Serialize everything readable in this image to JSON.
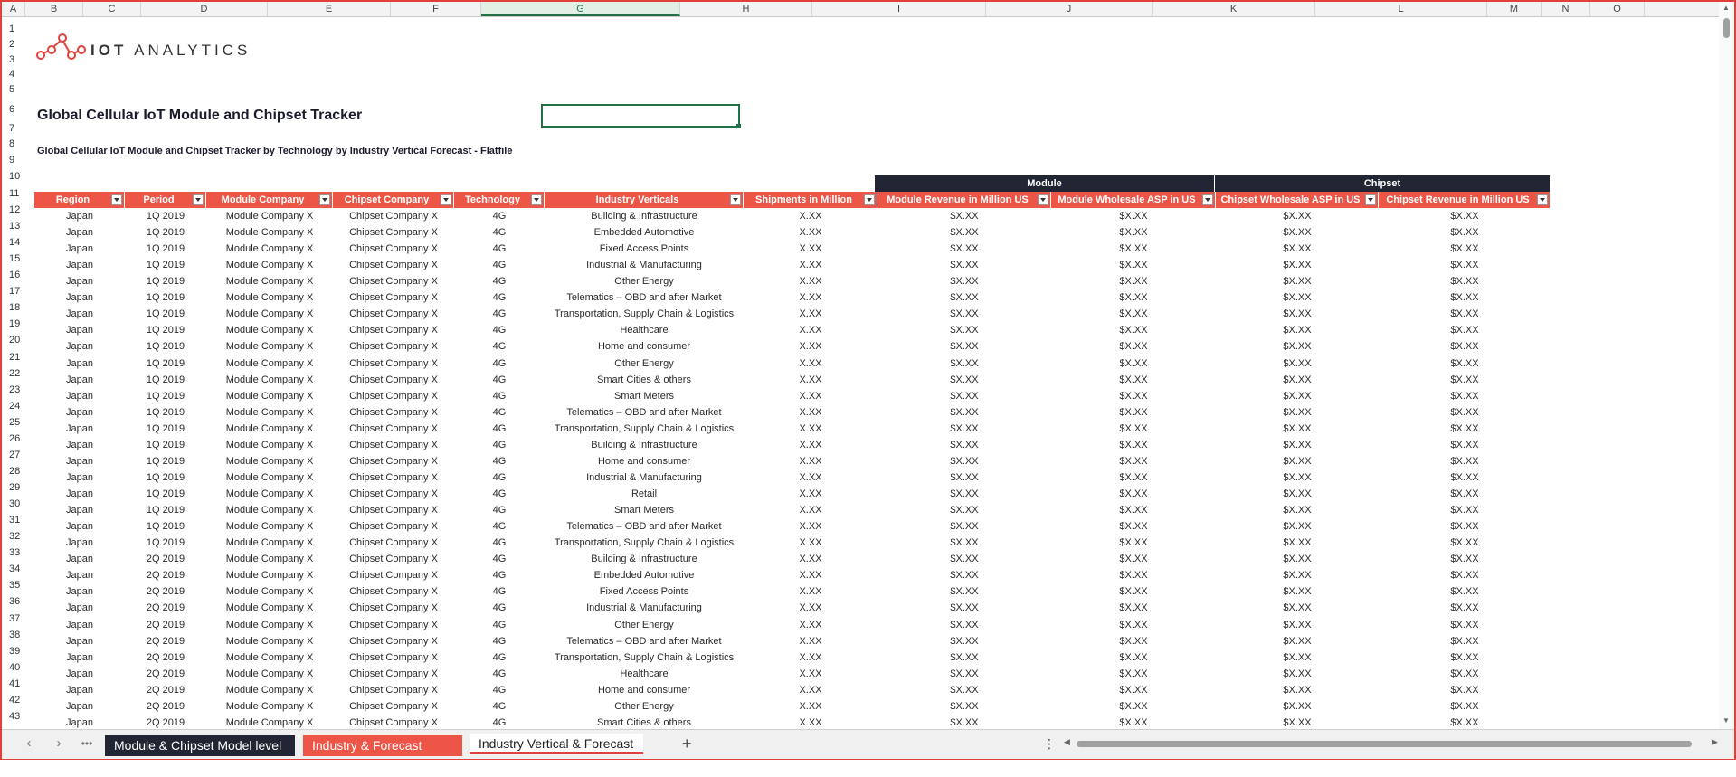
{
  "columns": [
    "A",
    "B",
    "C",
    "D",
    "E",
    "F",
    "G",
    "H",
    "I",
    "J",
    "K",
    "L",
    "M",
    "N",
    "O"
  ],
  "selected_column": "G",
  "rows": [
    "1",
    "2",
    "3",
    "4",
    "5",
    "6",
    "7",
    "8",
    "9",
    "10",
    "11",
    "12",
    "13",
    "14",
    "15",
    "16",
    "17",
    "18",
    "19",
    "20",
    "21",
    "22",
    "23",
    "24",
    "25",
    "26",
    "27",
    "28",
    "29",
    "30",
    "31",
    "32",
    "33",
    "34",
    "35",
    "36",
    "37",
    "38",
    "39",
    "40",
    "41",
    "42",
    "43"
  ],
  "brand": {
    "strong": "IOT",
    "rest": "ANALYTICS"
  },
  "title": "Global Cellular IoT Module and Chipset Tracker",
  "subtitle": "Global Cellular IoT Module and Chipset Tracker by Technology by Industry Vertical Forecast - Flatfile",
  "groups": {
    "module": "Module",
    "chipset": "Chipset"
  },
  "headers": [
    "Region",
    "Period",
    "Module Company",
    "Chipset Company",
    "Technology",
    "Industry Verticals",
    "Shipments in Million",
    "Module Revenue in Million US",
    "Module Wholesale ASP in US",
    "Chipset Wholesale ASP in US",
    "Chipset Revenue in Million US"
  ],
  "table_rows": [
    [
      "Japan",
      "1Q 2019",
      "Module Company X",
      "Chipset Company X",
      "4G",
      "Building & Infrastructure",
      "X.XX",
      "$X.XX",
      "$X.XX",
      "$X.XX",
      "$X.XX"
    ],
    [
      "Japan",
      "1Q 2019",
      "Module Company X",
      "Chipset Company X",
      "4G",
      "Embedded Automotive",
      "X.XX",
      "$X.XX",
      "$X.XX",
      "$X.XX",
      "$X.XX"
    ],
    [
      "Japan",
      "1Q 2019",
      "Module Company X",
      "Chipset Company X",
      "4G",
      "Fixed Access Points",
      "X.XX",
      "$X.XX",
      "$X.XX",
      "$X.XX",
      "$X.XX"
    ],
    [
      "Japan",
      "1Q 2019",
      "Module Company X",
      "Chipset Company X",
      "4G",
      "Industrial & Manufacturing",
      "X.XX",
      "$X.XX",
      "$X.XX",
      "$X.XX",
      "$X.XX"
    ],
    [
      "Japan",
      "1Q 2019",
      "Module Company X",
      "Chipset Company X",
      "4G",
      "Other Energy",
      "X.XX",
      "$X.XX",
      "$X.XX",
      "$X.XX",
      "$X.XX"
    ],
    [
      "Japan",
      "1Q 2019",
      "Module Company X",
      "Chipset Company X",
      "4G",
      "Telematics – OBD and after Market",
      "X.XX",
      "$X.XX",
      "$X.XX",
      "$X.XX",
      "$X.XX"
    ],
    [
      "Japan",
      "1Q 2019",
      "Module Company X",
      "Chipset Company X",
      "4G",
      "Transportation, Supply Chain & Logistics",
      "X.XX",
      "$X.XX",
      "$X.XX",
      "$X.XX",
      "$X.XX"
    ],
    [
      "Japan",
      "1Q 2019",
      "Module Company X",
      "Chipset Company X",
      "4G",
      "Healthcare",
      "X.XX",
      "$X.XX",
      "$X.XX",
      "$X.XX",
      "$X.XX"
    ],
    [
      "Japan",
      "1Q 2019",
      "Module Company X",
      "Chipset Company X",
      "4G",
      "Home and consumer",
      "X.XX",
      "$X.XX",
      "$X.XX",
      "$X.XX",
      "$X.XX"
    ],
    [
      "Japan",
      "1Q 2019",
      "Module Company X",
      "Chipset Company X",
      "4G",
      "Other Energy",
      "X.XX",
      "$X.XX",
      "$X.XX",
      "$X.XX",
      "$X.XX"
    ],
    [
      "Japan",
      "1Q 2019",
      "Module Company X",
      "Chipset Company X",
      "4G",
      "Smart Cities & others",
      "X.XX",
      "$X.XX",
      "$X.XX",
      "$X.XX",
      "$X.XX"
    ],
    [
      "Japan",
      "1Q 2019",
      "Module Company X",
      "Chipset Company X",
      "4G",
      "Smart Meters",
      "X.XX",
      "$X.XX",
      "$X.XX",
      "$X.XX",
      "$X.XX"
    ],
    [
      "Japan",
      "1Q 2019",
      "Module Company X",
      "Chipset Company X",
      "4G",
      "Telematics – OBD and after Market",
      "X.XX",
      "$X.XX",
      "$X.XX",
      "$X.XX",
      "$X.XX"
    ],
    [
      "Japan",
      "1Q 2019",
      "Module Company X",
      "Chipset Company X",
      "4G",
      "Transportation, Supply Chain & Logistics",
      "X.XX",
      "$X.XX",
      "$X.XX",
      "$X.XX",
      "$X.XX"
    ],
    [
      "Japan",
      "1Q 2019",
      "Module Company X",
      "Chipset Company X",
      "4G",
      "Building & Infrastructure",
      "X.XX",
      "$X.XX",
      "$X.XX",
      "$X.XX",
      "$X.XX"
    ],
    [
      "Japan",
      "1Q 2019",
      "Module Company X",
      "Chipset Company X",
      "4G",
      "Home and consumer",
      "X.XX",
      "$X.XX",
      "$X.XX",
      "$X.XX",
      "$X.XX"
    ],
    [
      "Japan",
      "1Q 2019",
      "Module Company X",
      "Chipset Company X",
      "4G",
      "Industrial & Manufacturing",
      "X.XX",
      "$X.XX",
      "$X.XX",
      "$X.XX",
      "$X.XX"
    ],
    [
      "Japan",
      "1Q 2019",
      "Module Company X",
      "Chipset Company X",
      "4G",
      "Retail",
      "X.XX",
      "$X.XX",
      "$X.XX",
      "$X.XX",
      "$X.XX"
    ],
    [
      "Japan",
      "1Q 2019",
      "Module Company X",
      "Chipset Company X",
      "4G",
      "Smart Meters",
      "X.XX",
      "$X.XX",
      "$X.XX",
      "$X.XX",
      "$X.XX"
    ],
    [
      "Japan",
      "1Q 2019",
      "Module Company X",
      "Chipset Company X",
      "4G",
      "Telematics – OBD and after Market",
      "X.XX",
      "$X.XX",
      "$X.XX",
      "$X.XX",
      "$X.XX"
    ],
    [
      "Japan",
      "1Q 2019",
      "Module Company X",
      "Chipset Company X",
      "4G",
      "Transportation, Supply Chain & Logistics",
      "X.XX",
      "$X.XX",
      "$X.XX",
      "$X.XX",
      "$X.XX"
    ],
    [
      "Japan",
      "2Q 2019",
      "Module Company X",
      "Chipset Company X",
      "4G",
      "Building & Infrastructure",
      "X.XX",
      "$X.XX",
      "$X.XX",
      "$X.XX",
      "$X.XX"
    ],
    [
      "Japan",
      "2Q 2019",
      "Module Company X",
      "Chipset Company X",
      "4G",
      "Embedded Automotive",
      "X.XX",
      "$X.XX",
      "$X.XX",
      "$X.XX",
      "$X.XX"
    ],
    [
      "Japan",
      "2Q 2019",
      "Module Company X",
      "Chipset Company X",
      "4G",
      "Fixed Access Points",
      "X.XX",
      "$X.XX",
      "$X.XX",
      "$X.XX",
      "$X.XX"
    ],
    [
      "Japan",
      "2Q 2019",
      "Module Company X",
      "Chipset Company X",
      "4G",
      "Industrial & Manufacturing",
      "X.XX",
      "$X.XX",
      "$X.XX",
      "$X.XX",
      "$X.XX"
    ],
    [
      "Japan",
      "2Q 2019",
      "Module Company X",
      "Chipset Company X",
      "4G",
      "Other Energy",
      "X.XX",
      "$X.XX",
      "$X.XX",
      "$X.XX",
      "$X.XX"
    ],
    [
      "Japan",
      "2Q 2019",
      "Module Company X",
      "Chipset Company X",
      "4G",
      "Telematics – OBD and after Market",
      "X.XX",
      "$X.XX",
      "$X.XX",
      "$X.XX",
      "$X.XX"
    ],
    [
      "Japan",
      "2Q 2019",
      "Module Company X",
      "Chipset Company X",
      "4G",
      "Transportation, Supply Chain & Logistics",
      "X.XX",
      "$X.XX",
      "$X.XX",
      "$X.XX",
      "$X.XX"
    ],
    [
      "Japan",
      "2Q 2019",
      "Module Company X",
      "Chipset Company X",
      "4G",
      "Healthcare",
      "X.XX",
      "$X.XX",
      "$X.XX",
      "$X.XX",
      "$X.XX"
    ],
    [
      "Japan",
      "2Q 2019",
      "Module Company X",
      "Chipset Company X",
      "4G",
      "Home and consumer",
      "X.XX",
      "$X.XX",
      "$X.XX",
      "$X.XX",
      "$X.XX"
    ],
    [
      "Japan",
      "2Q 2019",
      "Module Company X",
      "Chipset Company X",
      "4G",
      "Other Energy",
      "X.XX",
      "$X.XX",
      "$X.XX",
      "$X.XX",
      "$X.XX"
    ],
    [
      "Japan",
      "2Q 2019",
      "Module Company X",
      "Chipset Company X",
      "4G",
      "Smart Cities & others",
      "X.XX",
      "$X.XX",
      "$X.XX",
      "$X.XX",
      "$X.XX"
    ]
  ],
  "tabs": [
    "Module & Chipset Model level",
    "Industry & Forecast Pivot",
    "Industry Vertical & Forecast"
  ],
  "active_tab": "Industry Vertical & Forecast",
  "colors": {
    "accent": "#ed5547",
    "dark": "#222634",
    "selection": "#217346"
  },
  "icons": [
    "prev-sheet-icon",
    "next-sheet-icon",
    "more-sheets-icon",
    "add-sheet-icon",
    "options-icon",
    "filter-dropdown-icon",
    "iot-logo-icon"
  ]
}
